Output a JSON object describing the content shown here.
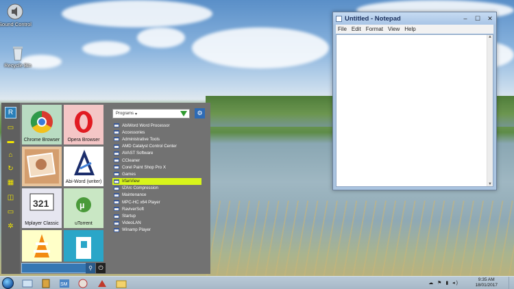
{
  "desktop_icons": [
    {
      "label": "Sound Control",
      "icon": "speaker-icon"
    },
    {
      "label": "Recycle Bin",
      "icon": "recycle-bin-icon"
    }
  ],
  "notepad": {
    "title": "Untitled - Notepad",
    "menu": [
      "File",
      "Edit",
      "Format",
      "View",
      "Help"
    ],
    "controls": {
      "minimize": "–",
      "maximize": "☐",
      "close": "✕"
    }
  },
  "start_menu": {
    "tiles": [
      {
        "label": "Chrome Browser",
        "bg": "#b9dcc2"
      },
      {
        "label": "Opera Browser",
        "bg": "#f4c6c6"
      },
      {
        "label": "",
        "bg": "#e8c49c"
      },
      {
        "label": "Abi-Word (writer)",
        "bg": "#ffffff"
      },
      {
        "label": "Mplayer Classic",
        "bg": "#e6e6f0"
      },
      {
        "label": "uTorrent",
        "bg": "#c9e7c4"
      },
      {
        "label": "",
        "bg": "#ffffc8"
      },
      {
        "label": "",
        "bg": "#2aa6c8"
      }
    ],
    "dropdown_value": "Programs",
    "programs": [
      "AbiWord Word Processor",
      "Accessories",
      "Administrative Tools",
      "AMD Catalyst Control Center",
      "AVAST Software",
      "CCleaner",
      "Corel Paint Shop Pro X",
      "Games",
      "IrfanView",
      "IZArc Compression",
      "Maintenance",
      "MPC-HC x64 Player",
      "RaviverSoft",
      "Startup",
      "VideoLAN",
      "Winamp Player"
    ],
    "selected_index": 8,
    "search_placeholder": ""
  },
  "taskbar": {
    "clock_time": "9:35 AM",
    "clock_date": "18/01/2017"
  },
  "colors": {
    "highlight": "#d8f51b",
    "rail_accent": "#f2e600",
    "start_blue": "#2a7fb8"
  }
}
